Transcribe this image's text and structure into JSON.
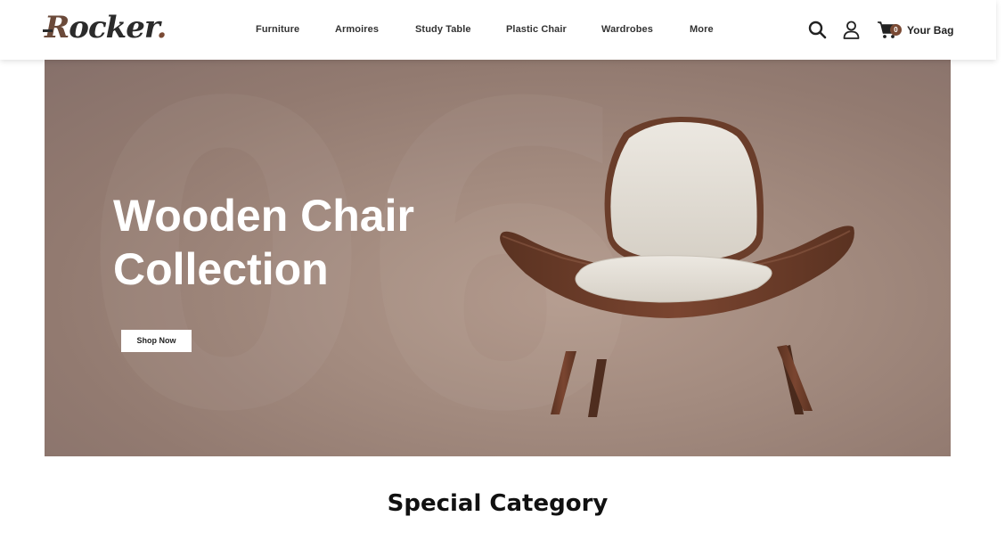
{
  "header": {
    "logo": {
      "initial": "R",
      "rest": "ocker",
      "dot": "."
    },
    "nav": [
      {
        "label": "Furniture"
      },
      {
        "label": "Armoires"
      },
      {
        "label": "Study Table"
      },
      {
        "label": "Plastic Chair"
      },
      {
        "label": "Wardrobes"
      },
      {
        "label": "More"
      }
    ],
    "icons": [
      "search-icon",
      "user-icon",
      "cart-icon"
    ],
    "bag": {
      "count": "0",
      "label": "Your Bag"
    }
  },
  "hero": {
    "title_line1": "Wooden Chair",
    "title_line2": "Collection",
    "button": "Shop Now",
    "image": "wooden-shell-chair"
  },
  "section": {
    "title": "Special Category"
  },
  "colors": {
    "accent": "#7a4a34",
    "hero_bg": "#a38b7f",
    "text": "#222222"
  }
}
